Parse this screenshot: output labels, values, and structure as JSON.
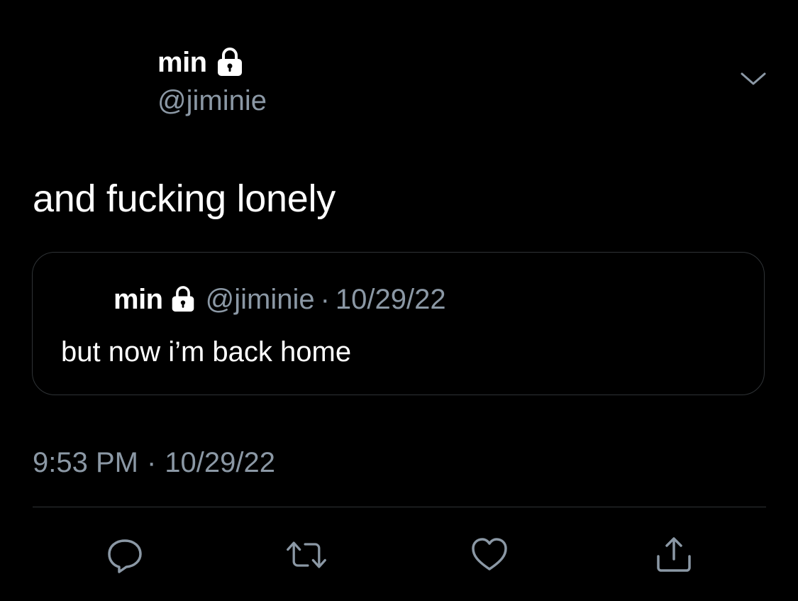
{
  "tweet": {
    "author_name": "min",
    "author_handle": "@jiminie",
    "text": "and fucking lonely",
    "time": "9:53 PM",
    "separator": "·",
    "date": "10/29/22"
  },
  "quoted_tweet": {
    "author_name": "min",
    "author_handle": "@jiminie",
    "separator": "·",
    "date": "10/29/22",
    "text": "but now i’m back home"
  },
  "icons": {
    "protected": "lock-icon",
    "menu": "chevron-down-icon",
    "reply": "reply-icon",
    "retweet": "retweet-icon",
    "like": "heart-icon",
    "share": "share-icon"
  },
  "colors": {
    "background": "#000000",
    "primary_text": "#ffffff",
    "secondary_text": "#8b98a5",
    "border": "#2f3336",
    "icon": "#8b98a5"
  }
}
